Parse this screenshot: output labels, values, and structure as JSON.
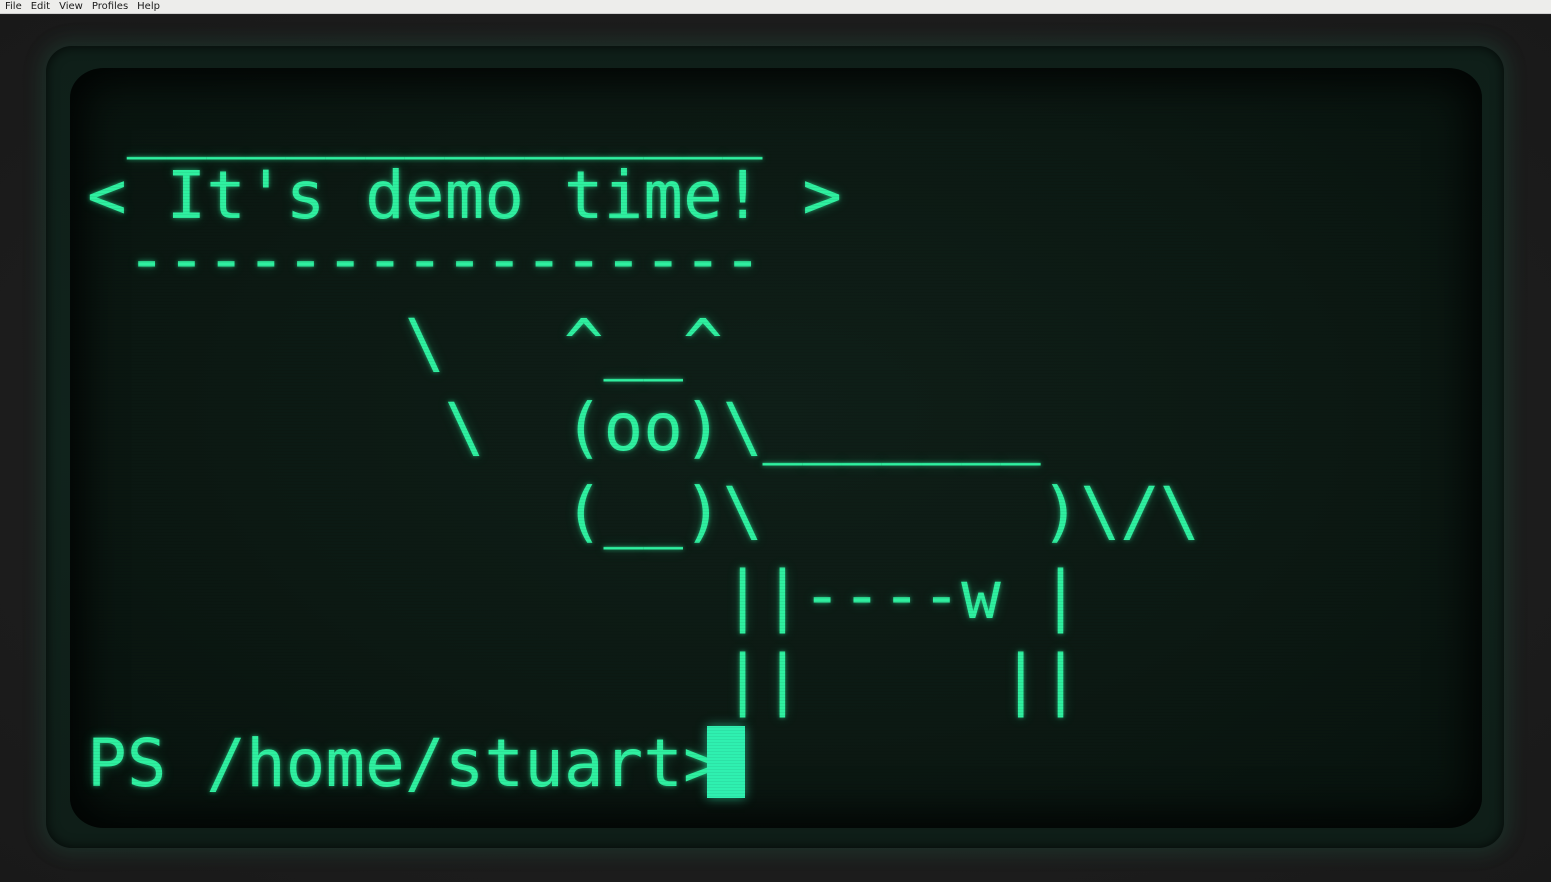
{
  "menubar": {
    "items": [
      "File",
      "Edit",
      "View",
      "Profiles",
      "Help"
    ]
  },
  "terminal": {
    "lines": [
      " ________________",
      "< It's demo time! >",
      " ----------------",
      "        \\   ^__^",
      "         \\  (oo)\\_______",
      "            (__)\\       )\\/\\",
      "                ||----w |",
      "                ||     ||"
    ],
    "prompt": "PS /home/stuart> ",
    "colors": {
      "phosphor": "#2ff0a0",
      "screen_bg": "#0c1913",
      "bezel": "#10231c"
    }
  }
}
